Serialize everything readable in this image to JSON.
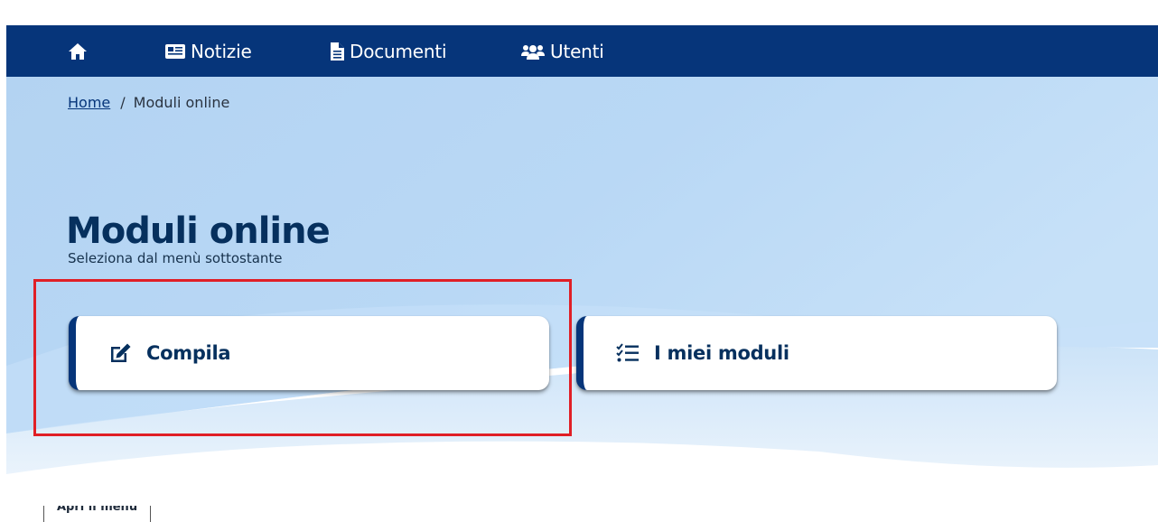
{
  "nav": {
    "items": [
      {
        "label": "",
        "icon": "home-icon"
      },
      {
        "label": "Notizie",
        "icon": "newspaper-icon"
      },
      {
        "label": "Documenti",
        "icon": "document-icon"
      },
      {
        "label": "Utenti",
        "icon": "users-icon"
      }
    ]
  },
  "breadcrumb": {
    "home": "Home",
    "separator": "/",
    "current": "Moduli online"
  },
  "page": {
    "title": "Moduli online",
    "subtitle": "Seleziona dal menù sottostante"
  },
  "cards": [
    {
      "label": "Compila",
      "icon": "edit-icon"
    },
    {
      "label": "I miei moduli",
      "icon": "checklist-icon"
    }
  ],
  "footer": {
    "menu_toggle": "Apri il menu"
  },
  "colors": {
    "navbar": "#06357a",
    "hero_light": "#b5d6f4",
    "accent": "#06357a",
    "highlight": "#e01f26"
  }
}
